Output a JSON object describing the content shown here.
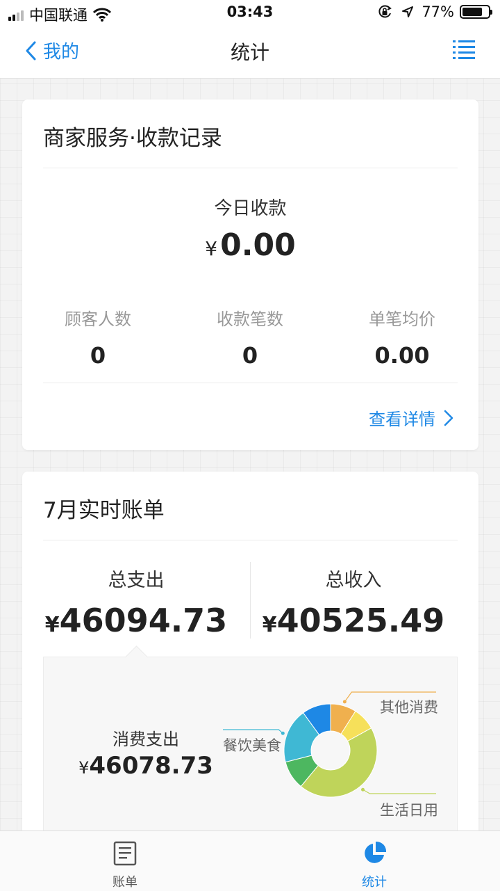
{
  "status_bar": {
    "carrier": "中国联通",
    "time": "03:43",
    "battery": "77%"
  },
  "nav": {
    "back_label": "我的",
    "title": "统计"
  },
  "merchant": {
    "title": "商家服务·收款记录",
    "today_label": "今日收款",
    "currency": "¥",
    "today_amount": "0.00",
    "stats": [
      {
        "label": "顾客人数",
        "value": "0"
      },
      {
        "label": "收款笔数",
        "value": "0"
      },
      {
        "label": "单笔均价",
        "value": "0.00"
      }
    ],
    "detail_link": "查看详情"
  },
  "bill": {
    "title": "7月实时账单",
    "currency": "¥",
    "expense_label": "总支出",
    "expense_amount": "46094.73",
    "income_label": "总收入",
    "income_amount": "40525.49",
    "consumption_label": "消费支出",
    "consumption_amount": "46078.73"
  },
  "chart_data": {
    "type": "pie",
    "donut": true,
    "slices": [
      {
        "label": "其他消费",
        "value": 9,
        "color": "#f0b04e"
      },
      {
        "label": "",
        "value": 8,
        "color": "#f6e05a"
      },
      {
        "label": "生活日用",
        "value": 44,
        "color": "#bfd45a"
      },
      {
        "label": "",
        "value": 10,
        "color": "#4db760"
      },
      {
        "label": "餐饮美食",
        "value": 19,
        "color": "#3fb8d4"
      },
      {
        "label": "",
        "value": 10,
        "color": "#1e88e5"
      }
    ]
  },
  "tabs": [
    {
      "label": "账单",
      "active": false
    },
    {
      "label": "统计",
      "active": true
    }
  ],
  "colors": {
    "accent": "#1e88e5",
    "text": "#333333",
    "muted": "#999999"
  },
  "icons": {
    "back": "chevron-left-icon",
    "menu": "list-menu-icon",
    "detail": "chevron-right-icon",
    "tab_bill": "document-icon",
    "tab_stats": "pie-chart-icon"
  }
}
